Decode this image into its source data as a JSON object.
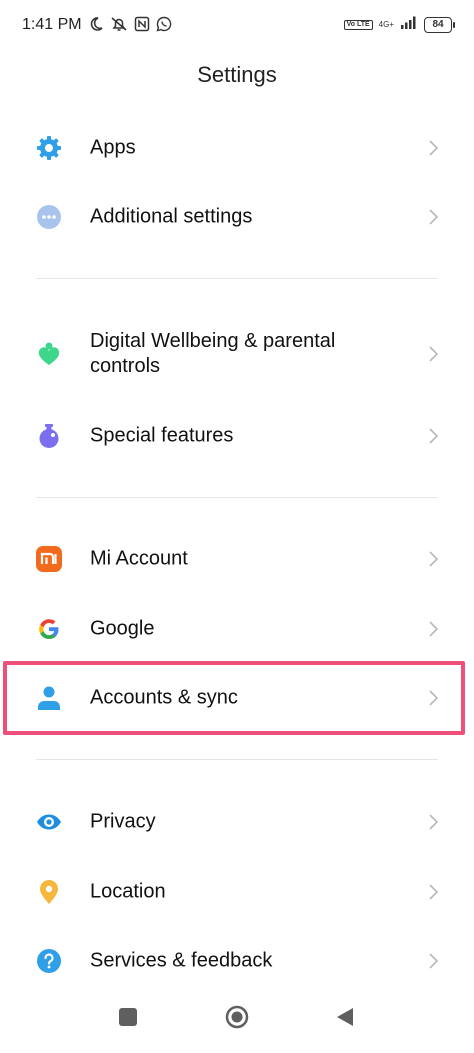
{
  "status_bar": {
    "time": "1:41 PM",
    "left_icons": [
      "moon-icon",
      "bell-off-icon",
      "nfc-icon",
      "whatsapp-icon"
    ],
    "network_type": "4G+",
    "volte_label": "Vo LTE",
    "battery": "84"
  },
  "header": {
    "title": "Settings"
  },
  "items": [
    {
      "label": "Apps",
      "icon": "gear-icon",
      "color": "#2f9fe8"
    },
    {
      "label": "Additional settings",
      "icon": "more-dots-icon",
      "color": "#a9c4ec"
    },
    {
      "label": "Digital Wellbeing & parental controls",
      "icon": "wellbeing-heart-icon",
      "color": "#3ed68a"
    },
    {
      "label": "Special features",
      "icon": "flask-icon",
      "color": "#7b6ff0"
    },
    {
      "label": "Mi Account",
      "icon": "mi-logo-icon",
      "color": "#f26a1e"
    },
    {
      "label": "Google",
      "icon": "google-logo-icon",
      "color": "#4285f4"
    },
    {
      "label": "Accounts & sync",
      "icon": "person-icon",
      "color": "#2f9fe8"
    },
    {
      "label": "Privacy",
      "icon": "eye-icon",
      "color": "#1e8fe0"
    },
    {
      "label": "Location",
      "icon": "location-pin-icon",
      "color": "#f6b73c"
    },
    {
      "label": "Services & feedback",
      "icon": "help-icon",
      "color": "#2f9fe8"
    }
  ],
  "highlight_color": "#ef5079",
  "nav_bar": {
    "buttons": [
      "recents-button",
      "home-button",
      "back-button"
    ]
  }
}
